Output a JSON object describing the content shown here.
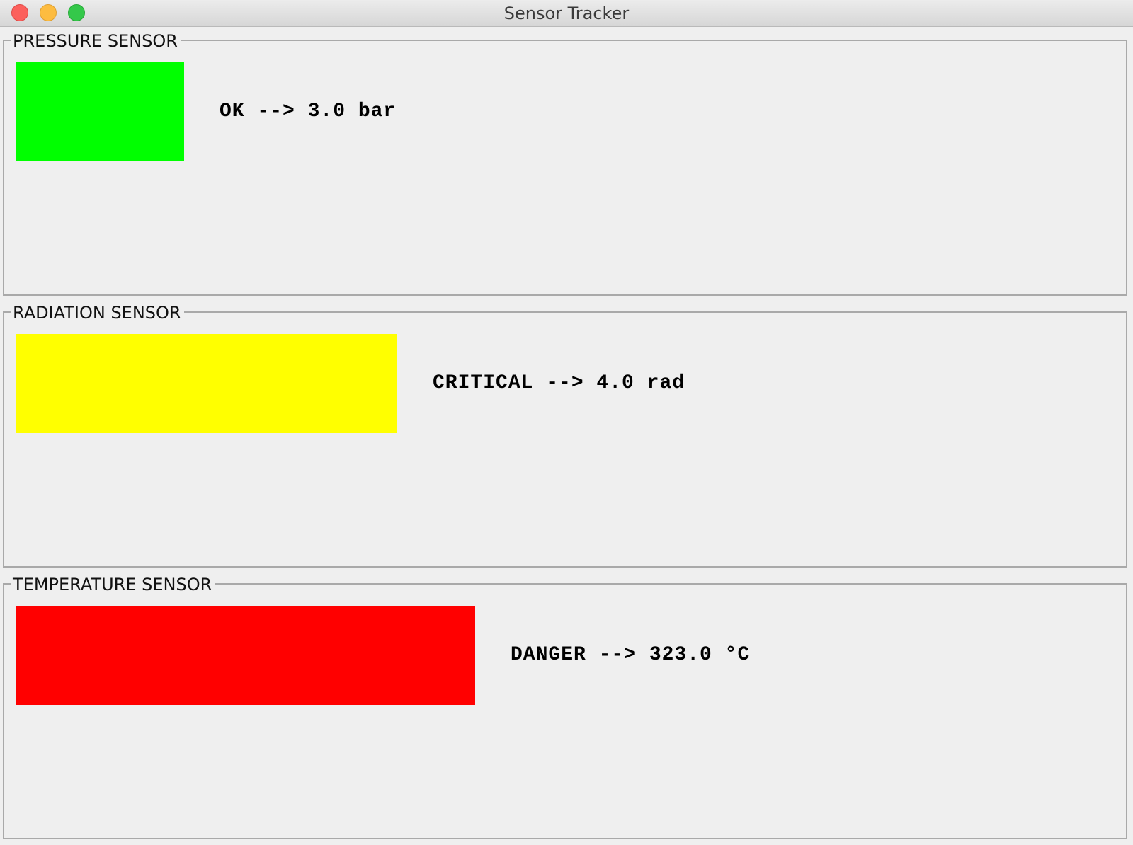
{
  "window": {
    "title": "Sensor Tracker"
  },
  "sensors": [
    {
      "name": "PRESSURE SENSOR",
      "status_text": "OK --> 3.0 bar",
      "bar_color": "#00ff00",
      "bar_level_percent": 15
    },
    {
      "name": "RADIATION SENSOR",
      "status_text": "CRITICAL --> 4.0 rad",
      "bar_color": "#ffff00",
      "bar_level_percent": 34
    },
    {
      "name": "TEMPERATURE SENSOR",
      "status_text": "DANGER --> 323.0 °C",
      "bar_color": "#ff0000",
      "bar_level_percent": 41
    }
  ],
  "icons": {
    "close": "close-window-icon",
    "minimize": "minimize-window-icon",
    "maximize": "maximize-window-icon"
  }
}
